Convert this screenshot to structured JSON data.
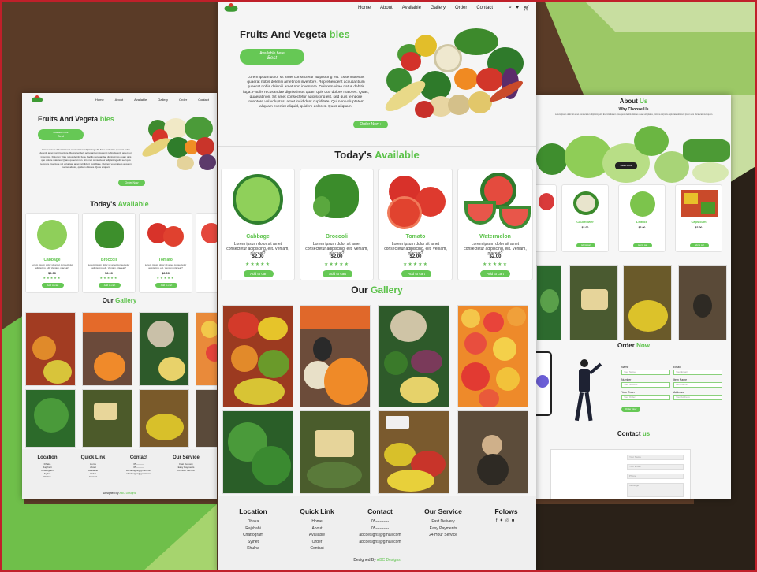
{
  "brand": {
    "logo": "logo-icon",
    "accent": "#5cc24a"
  },
  "nav": {
    "items": [
      "Home",
      "About",
      "Available",
      "Gallery",
      "Order",
      "Contact"
    ],
    "icons": [
      "search-icon",
      "heart-icon",
      "cart-icon"
    ]
  },
  "hero": {
    "title_main": "Fruits And Vegeta",
    "title_accent": "bles",
    "badge_line1": "Available here",
    "badge_line2": "Best",
    "body": "Lorem ipsum dolor sit amet consectetur adipisicing elit. Esse molestiis quaerat nobis deleniti amet non inventore. Reprehenderit accusantium quaerat nobis deleniti amet non inventore. Dolorem vitae natus debitis fuga. Facilis recusandae dignissimos quam quis quo dolore maiores. Quas, quaerat non. Sit amet consectetur adipisicing elit, sed quis tempore inventore vel voluptas, amet incididunt cupiditate. Qui non voluptatem aliquam eveniet aliquid, quidem dolores. Quos aliquam.",
    "cta": "Order Now"
  },
  "available": {
    "title_main": "Today's",
    "title_accent": "Available",
    "items": [
      {
        "name": "Cabbage",
        "desc": "Lorem ipsum dolor sit amet consectetur adipiscing, elit. Veniam, placeat?",
        "price": "$2.00",
        "button": "Add to cart"
      },
      {
        "name": "Broccoli",
        "desc": "Lorem ipsum dolor sit amet consectetur adipiscing, elit. Veniam, placeat?",
        "price": "$2.00",
        "button": "Add to cart"
      },
      {
        "name": "Tomato",
        "desc": "Lorem ipsum dolor sit amet consectetur adipiscing, elit. Veniam, placeat?",
        "price": "$2.00",
        "button": "Add to cart"
      },
      {
        "name": "Watermelon",
        "desc": "Lorem ipsum dolor sit amet consectetur adipiscing, elit. Veniam, placeat?",
        "price": "$2.00",
        "button": "Add to cart"
      }
    ],
    "rating": "★★★★★"
  },
  "gallery": {
    "title_main": "Our",
    "title_accent": "Gallery"
  },
  "footer": {
    "location": {
      "title": "Location",
      "items": [
        "Dhaka",
        "Rajshahi",
        "Chattogram",
        "Sylhet",
        "Khulna"
      ]
    },
    "quick": {
      "title": "Quick Link",
      "items": [
        "Home",
        "About",
        "Available",
        "Order",
        "Contact"
      ]
    },
    "contact": {
      "title": "Contact",
      "items": [
        "05----------",
        "05----------",
        "abcdesigns@gmail.com",
        "abcdesigns@gmail.com"
      ]
    },
    "service": {
      "title": "Our Service",
      "items": [
        "Fast Delivery",
        "Easy Payments",
        "24 Hour Service"
      ]
    },
    "follows": {
      "title": "Folows",
      "icons": [
        "facebook-icon",
        "twitter-icon",
        "instagram-icon",
        "linkedin-icon"
      ]
    },
    "designed_label": "Designed By",
    "designed_by": "ABC Designs"
  },
  "right": {
    "about_main": "About",
    "about_accent": "Us",
    "why": "Why Choose Us",
    "about_body": "Lorem ipsum dolor sit amet consectetur adipiscing elit. Exercitationem ipsa quos debitis dolores quae voluptates, minima corporis cupiditate dolorem ipsam eos obcaecati numquam.",
    "video_btn": "Read More",
    "cards": [
      {
        "name": "Cauliflower",
        "price": "$2.00"
      },
      {
        "name": "Lettuce",
        "price": "$2.00"
      },
      {
        "name": "Capsicum",
        "price": "$2.00"
      }
    ],
    "order_main": "Order",
    "order_accent": "Now",
    "order_fields": [
      {
        "label": "Name",
        "placeholder": "Your Name"
      },
      {
        "label": "Email",
        "placeholder": "Your Email"
      },
      {
        "label": "Number",
        "placeholder": "Your Number"
      },
      {
        "label": "Item Name",
        "placeholder": "Item Name"
      },
      {
        "label": "Your Order",
        "placeholder": "Your Order"
      },
      {
        "label": "Address",
        "placeholder": "Your Address"
      }
    ],
    "order_btn": "Order Now",
    "contact_main": "Contact",
    "contact_accent": "us",
    "contact_fields": [
      "Your Name",
      "Your Email",
      "Phone",
      "Message"
    ]
  }
}
